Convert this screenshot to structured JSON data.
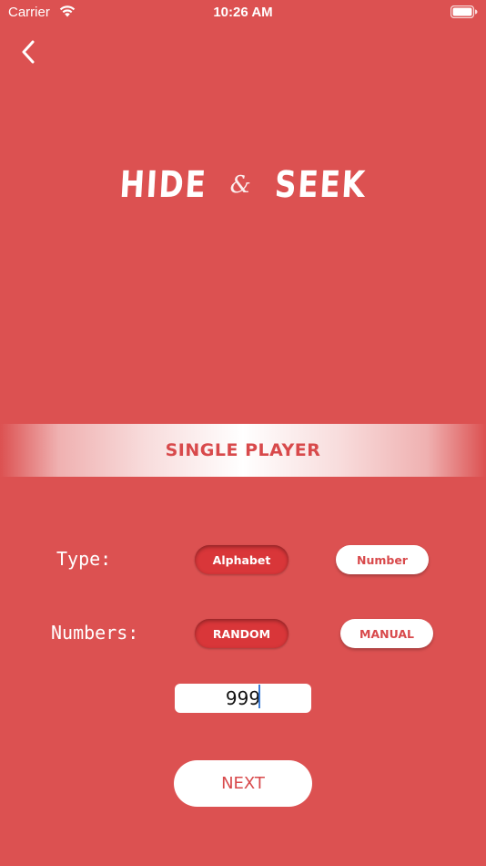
{
  "status_bar": {
    "carrier": "Carrier",
    "time": "10:26 AM"
  },
  "logo": {
    "word1": "HIDE",
    "ampersand": "&",
    "word2": "SEEK"
  },
  "banner": {
    "title": "SINGLE PLAYER"
  },
  "type_row": {
    "label": "Type:",
    "options": [
      "Alphabet",
      "Number"
    ],
    "selected": "Alphabet"
  },
  "numbers_row": {
    "label": "Numbers:",
    "options": [
      "RANDOM",
      "MANUAL"
    ],
    "selected": "RANDOM"
  },
  "count_input": {
    "value": "999"
  },
  "next_button": {
    "label": "NEXT"
  },
  "colors": {
    "background": "#dc5151",
    "accent_text": "#d8494b",
    "selected_pill": "#d93639",
    "caret": "#3a7bd5"
  },
  "icons": {
    "back": "chevron-left-icon",
    "wifi": "wifi-icon",
    "battery": "battery-icon"
  }
}
